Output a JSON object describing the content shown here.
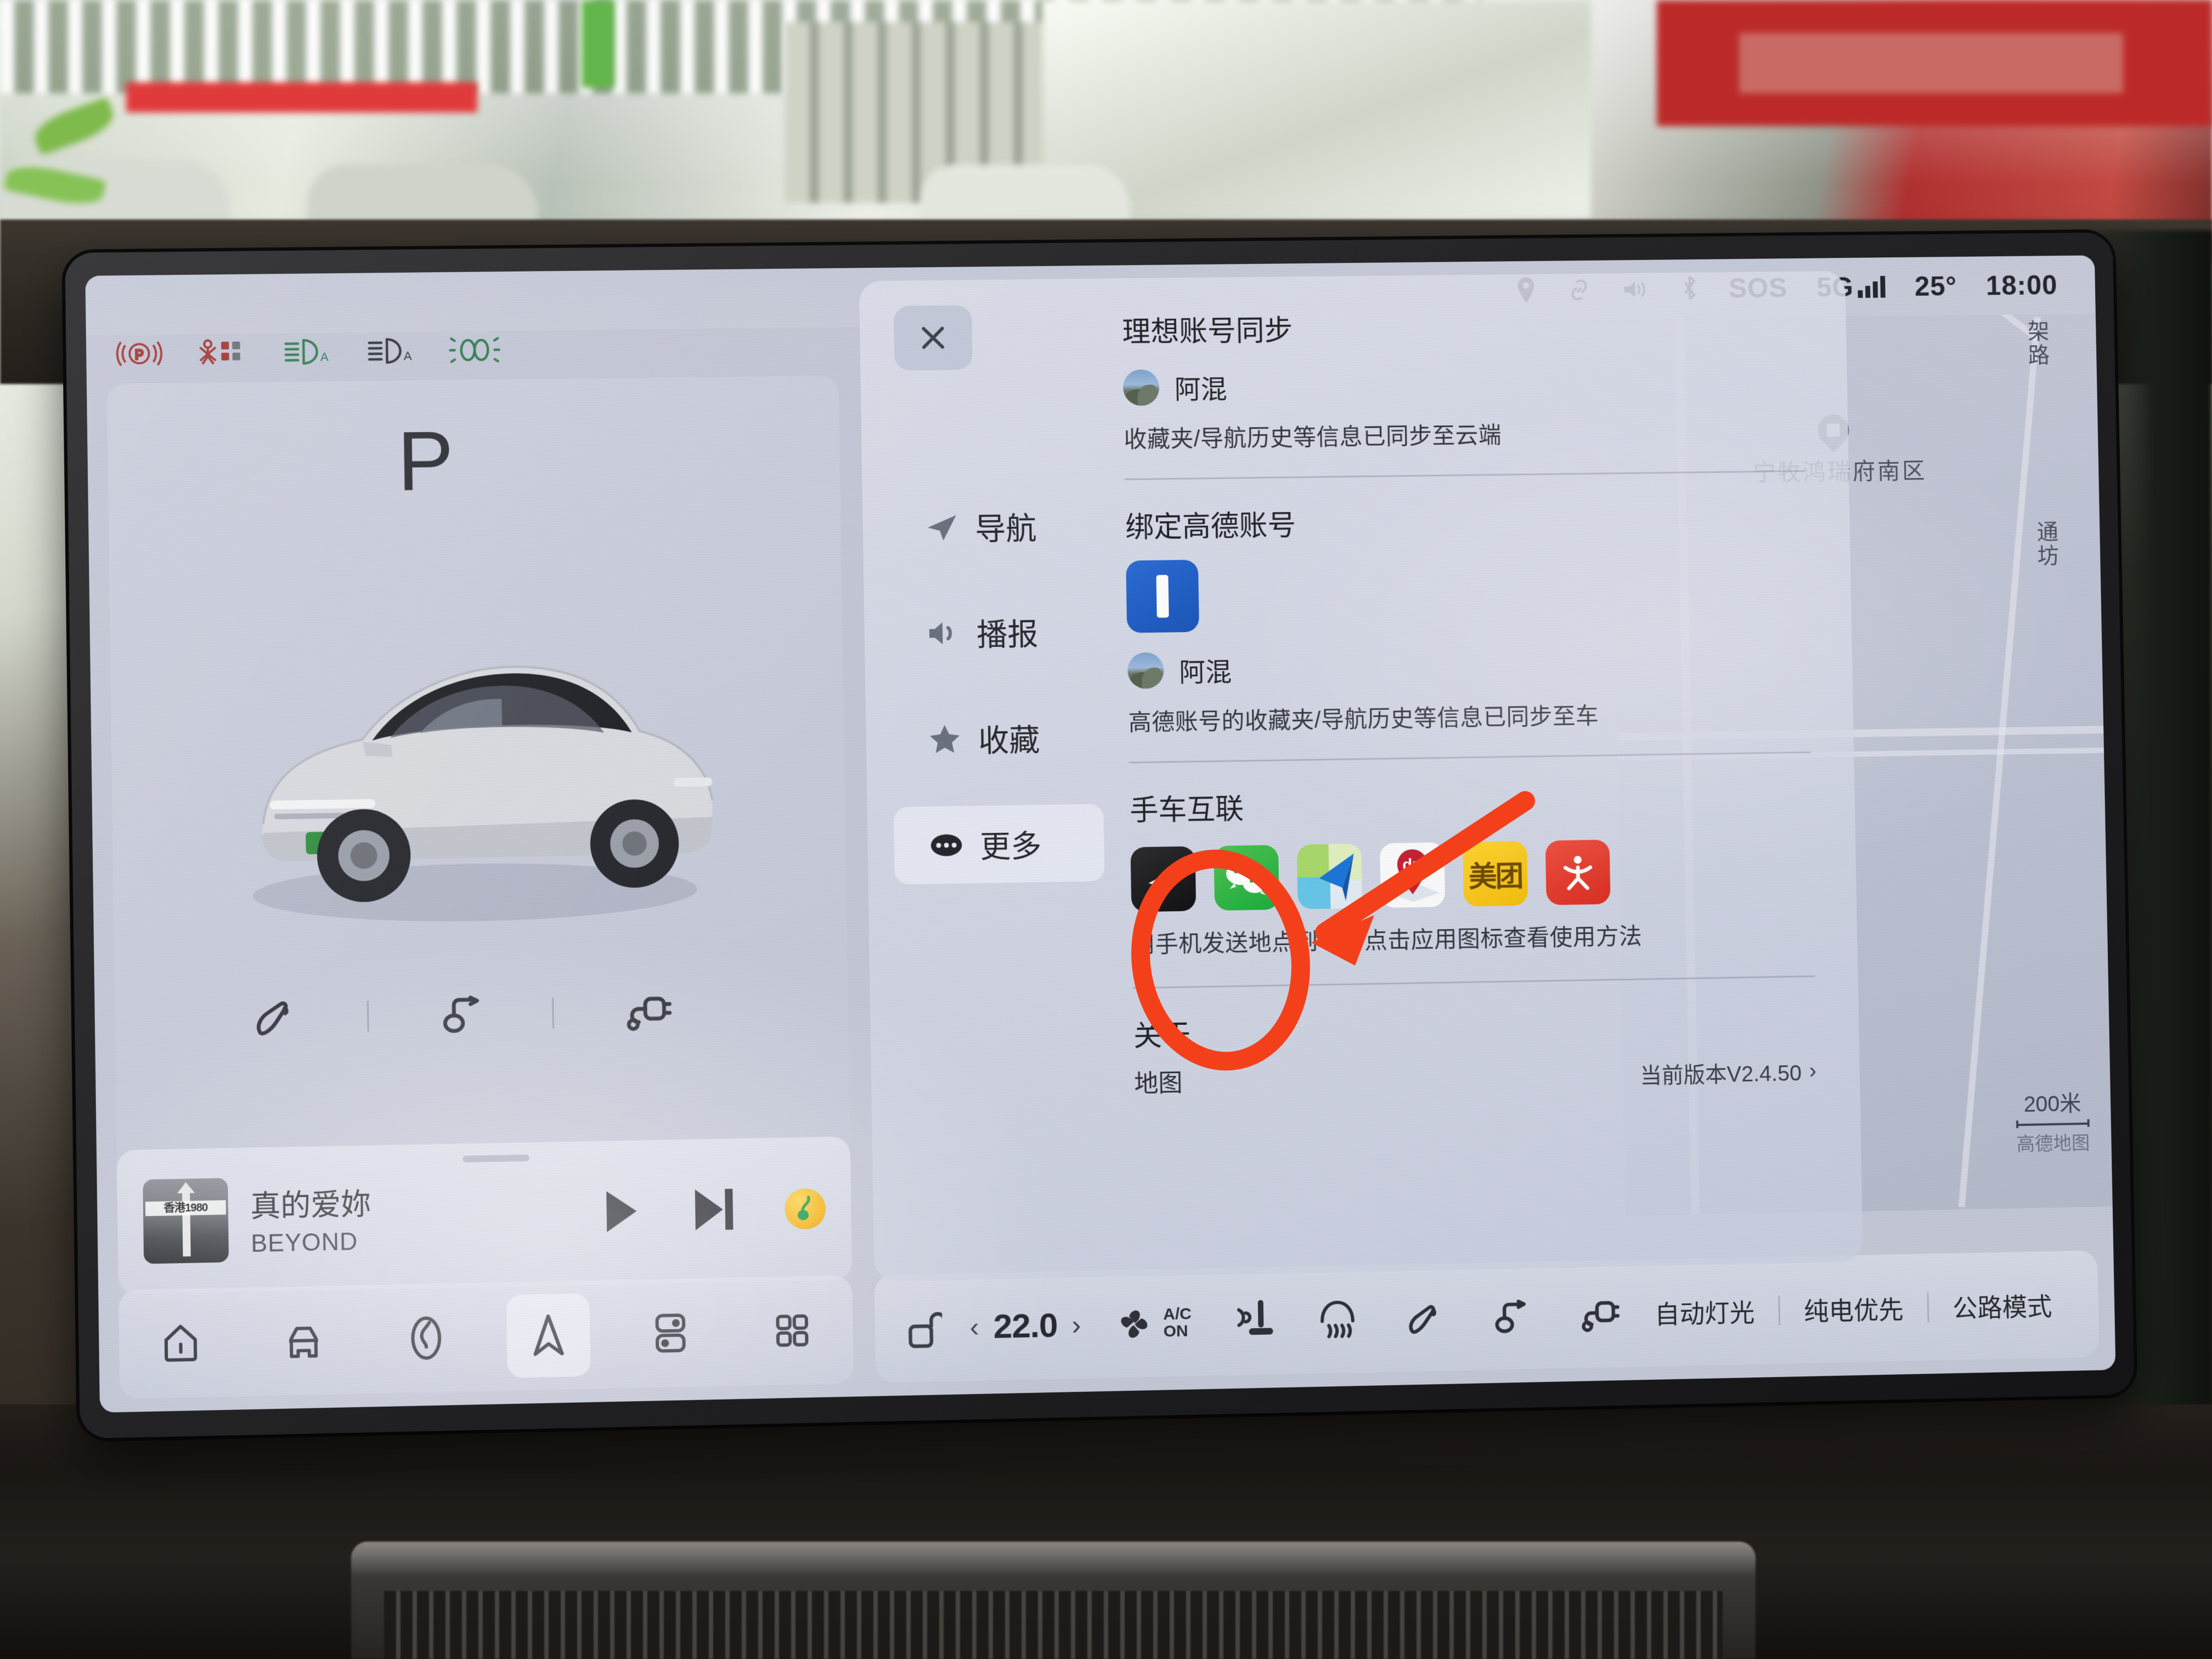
{
  "statusbar": {
    "icons": [
      "location-pin-icon",
      "link-icon",
      "volume-icon",
      "bluetooth-icon"
    ],
    "sos_label": "SOS",
    "network_label": "5G",
    "temperature": "25°",
    "time": "18:00"
  },
  "telltales": [
    {
      "name": "parking-brake-telltale",
      "label": "(P)",
      "color": "#a3332f"
    },
    {
      "name": "seatbelt-warning-telltale",
      "label": "seatbelt",
      "color": "#a3332f"
    },
    {
      "name": "auto-high-beam-telltale",
      "label": "A",
      "color": "#2f7a4f"
    },
    {
      "name": "auto-low-beam-telltale",
      "label": "A",
      "color": "#2f3238"
    },
    {
      "name": "headlight-telltale",
      "label": "lights",
      "color": "#2f7a4f"
    }
  ],
  "car_panel": {
    "gear": "P",
    "quick_controls": [
      {
        "name": "fuel-flap-icon",
        "label": "油箱盖"
      },
      {
        "name": "tailgate-icon",
        "label": "后备箱"
      },
      {
        "name": "charge-port-icon",
        "label": "充电口"
      }
    ]
  },
  "media": {
    "album_text": "香港1980",
    "title": "真的爱妳",
    "artist": "BEYOND",
    "play_label": "播放",
    "next_label": "下一首",
    "source": "qq-music"
  },
  "taskbar": {
    "items": [
      {
        "name": "home-icon",
        "label": "主页",
        "active": false
      },
      {
        "name": "car-icon",
        "label": "车辆",
        "active": false
      },
      {
        "name": "media-icon",
        "label": "音乐",
        "active": false
      },
      {
        "name": "navigation-icon",
        "label": "导航",
        "active": true
      },
      {
        "name": "split-screen-icon",
        "label": "分屏",
        "active": false
      },
      {
        "name": "apps-grid-icon",
        "label": "应用",
        "active": false
      }
    ]
  },
  "climate": {
    "lock_label": "解锁",
    "temperature": "22.0",
    "prev_label": "‹",
    "next_label": "›",
    "ac_line1": "A/C",
    "ac_line2": "ON",
    "icons": [
      {
        "name": "seat-heater-icon",
        "label": "座椅加热"
      },
      {
        "name": "rear-defrost-icon",
        "label": "后除霜"
      },
      {
        "name": "fuel-flap-icon",
        "label": "油箱盖"
      },
      {
        "name": "tailgate-icon",
        "label": "后备箱"
      },
      {
        "name": "charge-port-icon",
        "label": "充电口"
      }
    ],
    "modes": [
      "自动灯光",
      "纯电优先",
      "公路模式"
    ]
  },
  "dialog": {
    "close_label": "×",
    "nav": [
      {
        "name": "sidebar-item-navigation",
        "label": "导航",
        "icon": "navigation-arrow-icon",
        "active": false
      },
      {
        "name": "sidebar-item-broadcast",
        "label": "播报",
        "icon": "speaker-icon",
        "active": false
      },
      {
        "name": "sidebar-item-favorites",
        "label": "收藏",
        "icon": "star-icon",
        "active": false
      },
      {
        "name": "sidebar-item-more",
        "label": "更多",
        "icon": "ellipsis-icon",
        "active": true
      }
    ],
    "account_sync": {
      "title": "理想账号同步",
      "username": "阿混",
      "hint": "收藏夹/导航历史等信息已同步至云端"
    },
    "amap_bind": {
      "title": "绑定高德账号",
      "logo_name": "amap-logo",
      "username": "阿混",
      "hint": "高德账号的收藏夹/导航历史等信息已同步至车"
    },
    "phone_car": {
      "title": "手车互联",
      "apps": [
        {
          "name": "li-auto-app-icon",
          "label": "理想"
        },
        {
          "name": "wechat-app-icon",
          "label": "微信"
        },
        {
          "name": "amap-app-icon",
          "label": "高德地图"
        },
        {
          "name": "baidu-maps-app-icon",
          "label": "du"
        },
        {
          "name": "meituan-app-icon",
          "label": "美团"
        },
        {
          "name": "dianping-app-icon",
          "label": "大众点评"
        }
      ],
      "hint": "用手机发送地点到车，点击应用图标查看使用方法"
    },
    "about": {
      "title": "关于",
      "row_label": "地图",
      "version": "当前版本V2.4.50",
      "chevron": "›"
    }
  },
  "map": {
    "poi_label": "宁牧鸿瑞府南区",
    "street_labels": [
      "架路",
      "通坊"
    ],
    "scale_value": "200米",
    "provider": "高德地图"
  },
  "colors": {
    "accent_blue": "#2b6cd4",
    "annotation_red": "#f4401a",
    "wechat_green": "#1aad3d",
    "meituan_yellow": "#ffd42e",
    "warning_red": "#a3332f",
    "ok_green": "#2f7a4f"
  }
}
